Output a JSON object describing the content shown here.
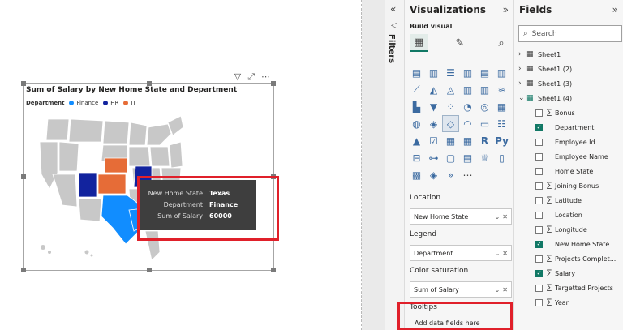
{
  "visual": {
    "title": "Sum of Salary by New Home State and Department",
    "legend_title": "Department",
    "legend": [
      {
        "name": "Finance",
        "color": "#118dff"
      },
      {
        "name": "HR",
        "color": "#12239e"
      },
      {
        "name": "IT",
        "color": "#e66c37"
      }
    ],
    "icons": [
      "filter-icon",
      "focus-mode-icon",
      "more-options-icon"
    ],
    "tooltip": [
      {
        "key": "New Home State",
        "value": "Texas"
      },
      {
        "key": "Department",
        "value": "Finance"
      },
      {
        "key": "Sum of Salary",
        "value": "60000"
      }
    ]
  },
  "filters": {
    "label": "Filters"
  },
  "visualizations": {
    "title": "Visualizations",
    "build_label": "Build visual",
    "wells": [
      {
        "label": "Location",
        "field": "New Home State"
      },
      {
        "label": "Legend",
        "field": "Department"
      },
      {
        "label": "Color saturation",
        "field": "Sum of Salary"
      },
      {
        "label": "Tooltips",
        "field": null,
        "placeholder": "Add data fields here"
      }
    ]
  },
  "fields": {
    "title": "Fields",
    "search_placeholder": "Search",
    "tables": [
      "Sheet1",
      "Sheet1 (2)",
      "Sheet1 (3)",
      "Sheet1 (4)"
    ],
    "items": [
      {
        "name": "Bonus",
        "checked": false,
        "sigma": true
      },
      {
        "name": "Department",
        "checked": true,
        "sigma": false
      },
      {
        "name": "Employee Id",
        "checked": false,
        "sigma": false
      },
      {
        "name": "Employee Name",
        "checked": false,
        "sigma": false
      },
      {
        "name": "Home State",
        "checked": false,
        "sigma": false
      },
      {
        "name": "Joining Bonus",
        "checked": false,
        "sigma": true
      },
      {
        "name": "Latitude",
        "checked": false,
        "sigma": true
      },
      {
        "name": "Location",
        "checked": false,
        "sigma": false
      },
      {
        "name": "Longitude",
        "checked": false,
        "sigma": true
      },
      {
        "name": "New Home State",
        "checked": true,
        "sigma": false
      },
      {
        "name": "Projects Complet...",
        "checked": false,
        "sigma": true
      },
      {
        "name": "Salary",
        "checked": true,
        "sigma": true
      },
      {
        "name": "Targetted Projects",
        "checked": false,
        "sigma": true
      },
      {
        "name": "Year",
        "checked": false,
        "sigma": true
      }
    ]
  },
  "colors": {
    "accent": "#117865",
    "highlight_box": "#e0202a",
    "map_gray": "#c8c8c8"
  }
}
